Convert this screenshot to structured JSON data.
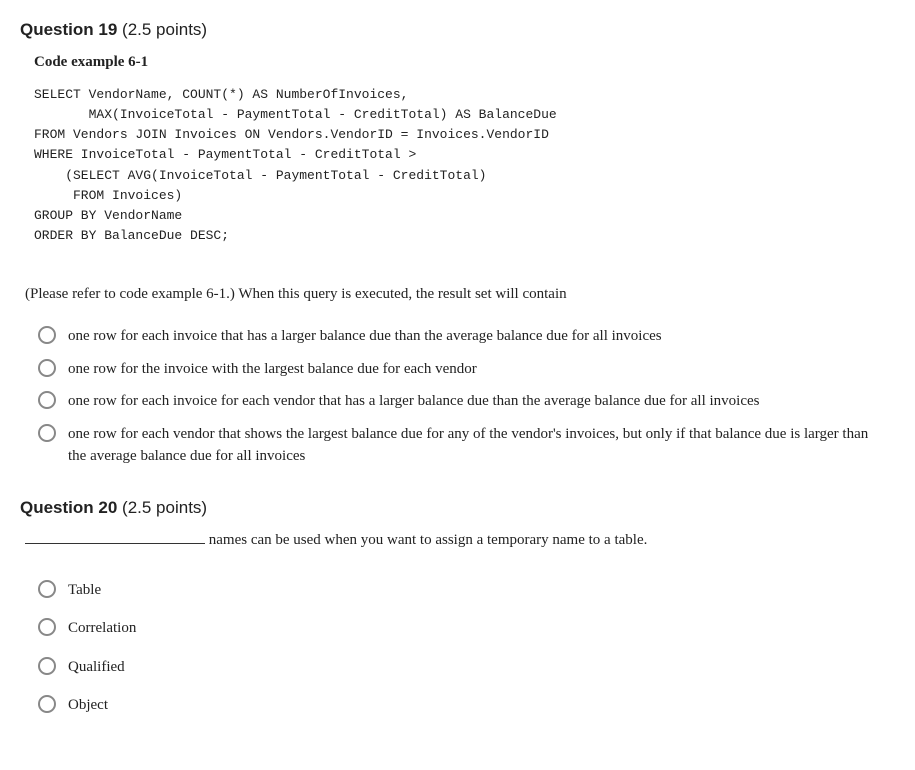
{
  "question19": {
    "header_title": "Question 19",
    "header_points": " (2.5 points)",
    "example_title": "Code example 6-1",
    "code": "SELECT VendorName, COUNT(*) AS NumberOfInvoices,\n       MAX(InvoiceTotal - PaymentTotal - CreditTotal) AS BalanceDue\nFROM Vendors JOIN Invoices ON Vendors.VendorID = Invoices.VendorID\nWHERE InvoiceTotal - PaymentTotal - CreditTotal >\n    (SELECT AVG(InvoiceTotal - PaymentTotal - CreditTotal)\n     FROM Invoices)\nGROUP BY VendorName\nORDER BY BalanceDue DESC;",
    "prompt": "(Please refer to code example 6-1.) When this query is executed, the result set will contain",
    "options": [
      "one row for each invoice that has a larger balance due than the average balance due for all invoices",
      "one row for the invoice with the largest balance due for each vendor",
      "one row for each invoice for each vendor that has a larger balance due than the average balance due for all invoices",
      "one row for each vendor that shows the largest balance due for any of the vendor's invoices, but only if that balance due is larger than the average balance due for all invoices"
    ]
  },
  "question20": {
    "header_title": "Question 20",
    "header_points": " (2.5 points)",
    "prompt_tail": " names can be used when you want to assign a temporary name to a table.",
    "options": [
      "Table",
      "Correlation",
      "Qualified",
      "Object"
    ]
  }
}
